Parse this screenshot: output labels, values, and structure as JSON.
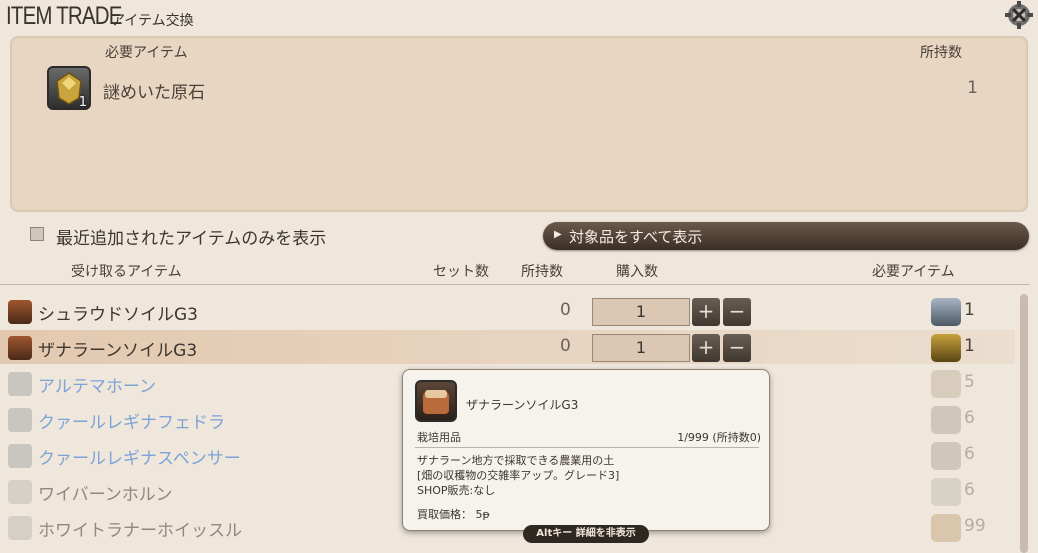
{
  "window": {
    "title_en": "ITEM TRADE",
    "title_jp": "アイテム交換"
  },
  "required_panel": {
    "header_label": "必要アイテム",
    "header_count": "所持数",
    "item": {
      "name": "謎めいた原石",
      "qty_badge": "1",
      "owned": "1",
      "icon": "gem-ore-icon"
    }
  },
  "filter": {
    "checkbox_label": "最近追加されたアイテムのみを表示",
    "checked": false
  },
  "show_all_button": {
    "label": "対象品をすべて表示"
  },
  "columns": {
    "receive": "受け取るアイテム",
    "set_count": "セット数",
    "owned": "所持数",
    "purchase_count": "購入数",
    "required": "必要アイテム"
  },
  "rows": [
    {
      "name": "シュラウドソイルG3",
      "owned": "0",
      "qty": "1",
      "req_qty": "1",
      "state": "active",
      "icon": "soil-bag-icon",
      "req_icon": "crystal-icon"
    },
    {
      "name": "ザナラーンソイルG3",
      "owned": "0",
      "qty": "1",
      "req_qty": "1",
      "state": "selected",
      "icon": "soil-bag-icon",
      "req_icon": "gem-ore-icon"
    },
    {
      "name": "アルテマホーン",
      "req_qty": "5",
      "state": "inactive",
      "icon": "horn-icon",
      "req_icon": "diamond-icon"
    },
    {
      "name": "クァールレギナフェドラ",
      "req_qty": "6",
      "state": "inactive",
      "icon": "hat-icon",
      "req_icon": "claw-icon"
    },
    {
      "name": "クァールレギナスペンサー",
      "req_qty": "6",
      "state": "inactive",
      "icon": "shirt-icon",
      "req_icon": "claw-icon"
    },
    {
      "name": "ワイバーンホルン",
      "req_qty": "6",
      "state": "grey",
      "icon": "star-icon",
      "req_icon": "scroll-icon"
    },
    {
      "name": "ホワイトラナーホイッスル",
      "req_qty": "99",
      "state": "grey",
      "icon": "star-icon",
      "req_icon": "coin-icon"
    }
  ],
  "stepper": {
    "plus": "+",
    "minus": "−"
  },
  "tooltip": {
    "name": "ザナラーンソイルG3",
    "category": "栽培用品",
    "stock": "1/999 (所持数0)",
    "description": [
      "ザナラーン地方で採取できる農業用の土",
      "[畑の収穫物の交雑率アップ。グレード3]",
      "SHOP販売:なし"
    ],
    "price": "買取価格： 5ᵽ"
  },
  "alt_hint": "Altキー 詳細を非表示",
  "colors": {
    "background": "#efe7dc",
    "panel": "#e8d6c2",
    "inactive_text": "#7ea3d7",
    "button_dark": "#3a2e24"
  }
}
